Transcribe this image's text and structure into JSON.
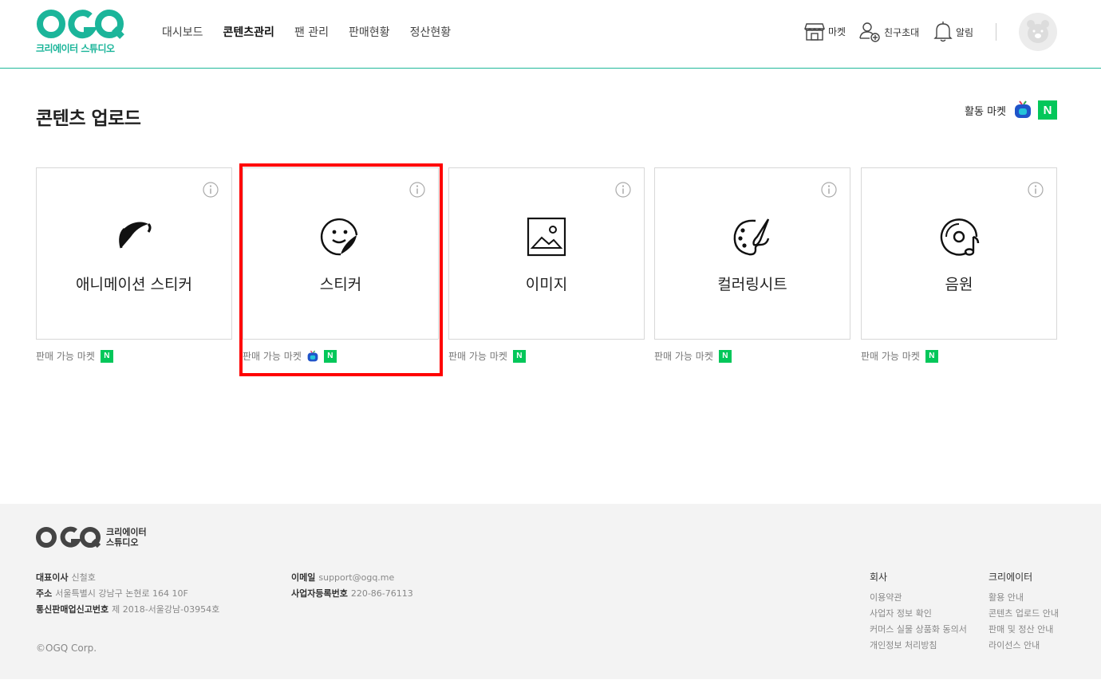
{
  "brand": {
    "logo_text": "OGQ",
    "sub": "크리에이터 스튜디오",
    "accent_color": "#1bb59a"
  },
  "nav": {
    "items": [
      {
        "label": "대시보드",
        "active": false
      },
      {
        "label": "콘텐츠관리",
        "active": true
      },
      {
        "label": "팬 관리",
        "active": false
      },
      {
        "label": "판매현황",
        "active": false
      },
      {
        "label": "정산현황",
        "active": false
      }
    ]
  },
  "utilities": {
    "market": {
      "label": "마켓",
      "icon": "store-icon"
    },
    "invite": {
      "label": "친구초대",
      "icon": "person-add-icon"
    },
    "alerts": {
      "label": "알림",
      "icon": "bell-icon"
    },
    "avatar": {
      "icon": "bear-avatar"
    }
  },
  "main": {
    "title": "콘텐츠 업로드",
    "active_market_label": "활동 마켓",
    "naver_badge": "N",
    "cards": [
      {
        "label": "애니메이션 스티커",
        "icon": "animation-sticker-icon",
        "sell_label": "판매 가능 마켓",
        "markets": [
          "naver"
        ]
      },
      {
        "label": "스티커",
        "icon": "sticker-face-icon",
        "sell_label": "판매 가능 마켓",
        "markets": [
          "afreeca",
          "naver"
        ],
        "highlighted": true
      },
      {
        "label": "이미지",
        "icon": "image-icon",
        "sell_label": "판매 가능 마켓",
        "markets": [
          "naver"
        ]
      },
      {
        "label": "컬러링시트",
        "icon": "palette-icon",
        "sell_label": "판매 가능 마켓",
        "markets": [
          "naver"
        ]
      },
      {
        "label": "음원",
        "icon": "music-disc-icon",
        "sell_label": "판매 가능 마켓",
        "markets": [
          "naver"
        ]
      }
    ]
  },
  "footer": {
    "logo_text": "OGQ",
    "sub_line1": "크리에이터",
    "sub_line2": "스튜디오",
    "ceo_label": "대표이사",
    "ceo_value": "신철호",
    "address_label": "주소",
    "address_value": "서울특별시 강남구 논현로 164 10F",
    "telecom_label": "통신판매업신고번호",
    "telecom_value": "제 2018-서울강남-03954호",
    "email_label": "이메일",
    "email_value": "support@ogq.me",
    "bizreg_label": "사업자등록번호",
    "bizreg_value": "220-86-76113",
    "copyright": "©OGQ Corp.",
    "company_title": "회사",
    "company_links": [
      "이용약관",
      "사업자 정보 확인",
      "커머스 실물 상품화 동의서",
      "개인정보 처리방침"
    ],
    "creator_title": "크리에이터",
    "creator_links": [
      "활용 안내",
      "콘텐츠 업로드 안내",
      "판매 및 정산 안내",
      "라이선스 안내"
    ]
  }
}
